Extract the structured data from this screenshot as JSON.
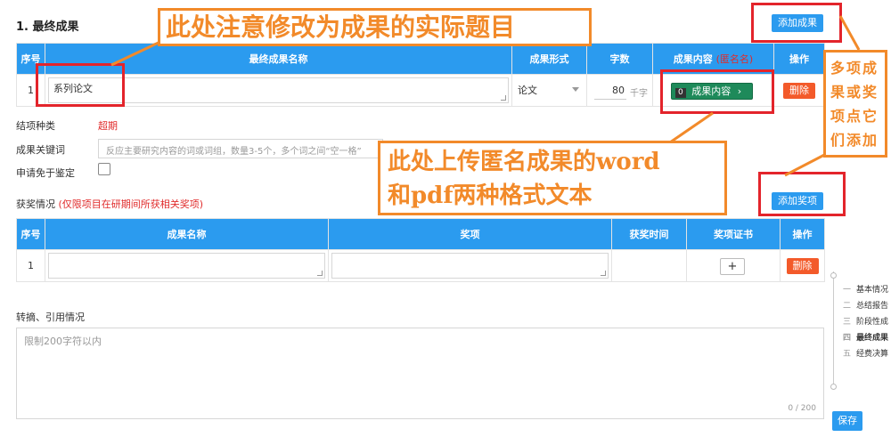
{
  "section": {
    "title": "1. 最终成果",
    "add_result_label": "添加成果"
  },
  "results_table": {
    "headers": {
      "index": "序号",
      "name": "最终成果名称",
      "form": "成果形式",
      "wordcount": "字数",
      "content": "成果内容",
      "content_hint": "(匿名名)",
      "action": "操作"
    },
    "row": {
      "index": "1",
      "name": "系列论文",
      "form": "论文",
      "wordcount": "80",
      "wordcount_unit": "千字",
      "content_badge": "0",
      "content_button": "成果内容",
      "delete": "删除"
    }
  },
  "meta_fields": {
    "completion_type_label": "结项种类",
    "completion_type_value": "超期",
    "keywords_label": "成果关键词",
    "keywords_placeholder": "反应主要研究内容的词或词组，数量3-5个，多个词之间“空一格”",
    "exempt_label": "申请免于鉴定"
  },
  "awards": {
    "label": "获奖情况",
    "hint": "(仅限项目在研期间所获相关奖项)",
    "add_label": "添加奖项",
    "headers": {
      "index": "序号",
      "name": "成果名称",
      "award": "奖项",
      "time": "获奖时间",
      "certificate": "奖项证书",
      "action": "操作"
    },
    "row": {
      "index": "1",
      "upload": "+",
      "delete": "删除"
    }
  },
  "citations": {
    "label": "转摘、引用情况",
    "placeholder": "限制200字符以内",
    "counter": "0 / 200"
  },
  "side_nav": {
    "items": [
      {
        "num": "一",
        "label": "基本情况"
      },
      {
        "num": "二",
        "label": "总结报告"
      },
      {
        "num": "三",
        "label": "阶段性成"
      },
      {
        "num": "四",
        "label": "最终成果"
      },
      {
        "num": "五",
        "label": "经费决算"
      }
    ],
    "save_label": "保存"
  },
  "annotations": {
    "title_note": "此处注意修改为成果的实际题目",
    "upload_note_line1": "此处上传匿名成果的word",
    "upload_note_line2": "和pdf两种格式文本",
    "multi_note": "多项成果或奖项点它们添加"
  },
  "colors": {
    "accent": "#2b9bef",
    "danger": "#f35a2a",
    "annotation_red": "#e3242b",
    "annotation_orange": "#f28a2a",
    "content_button": "#1e8a5a"
  }
}
